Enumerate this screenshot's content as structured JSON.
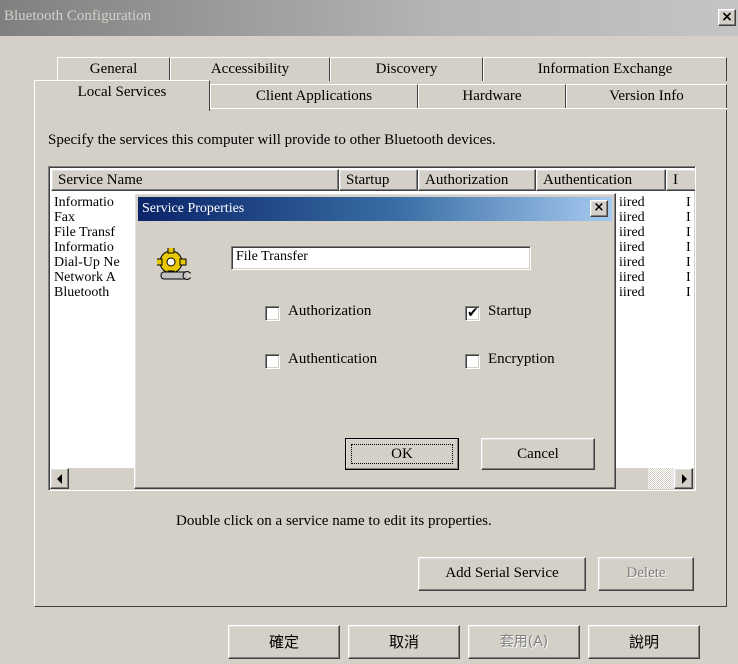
{
  "window": {
    "title": "Bluetooth Configuration",
    "close_glyph": "×"
  },
  "tabs": {
    "row1": [
      "General",
      "Accessibility",
      "Discovery",
      "Information Exchange"
    ],
    "row2": [
      "Local Services",
      "Client Applications",
      "Hardware",
      "Version Info"
    ],
    "selected": "Local Services"
  },
  "local_services": {
    "instruction": "Specify the services this computer will provide to other Bluetooth devices.",
    "columns": [
      "Service Name",
      "Startup",
      "Authorization",
      "Authentication",
      "I"
    ],
    "rows": [
      {
        "name": "Informatio",
        "auth_suffix": "iired",
        "last": "I"
      },
      {
        "name": "Fax",
        "auth_suffix": "iired",
        "last": "I"
      },
      {
        "name": "File Transf",
        "auth_suffix": "iired",
        "last": "I"
      },
      {
        "name": "Informatio",
        "auth_suffix": "iired",
        "last": "I"
      },
      {
        "name": "Dial-Up Ne",
        "auth_suffix": "iired",
        "last": "I"
      },
      {
        "name": "Network A",
        "auth_suffix": "iired",
        "last": "I"
      },
      {
        "name": "Bluetooth",
        "auth_suffix": "iired",
        "last": "I"
      }
    ],
    "help_text": "Double click on a service name to edit its properties.",
    "add_serial_label": "Add Serial Service",
    "delete_label": "Delete"
  },
  "service_properties": {
    "title": "Service Properties",
    "close_glyph": "×",
    "service_name": "File Transfer",
    "checkboxes": {
      "authorization": {
        "label": "Authorization",
        "checked": false
      },
      "startup": {
        "label": "Startup",
        "checked": true
      },
      "authentication": {
        "label": "Authentication",
        "checked": false
      },
      "encryption": {
        "label": "Encryption",
        "checked": false
      }
    },
    "ok_label": "OK",
    "cancel_label": "Cancel"
  },
  "footer": {
    "ok_label": "確定",
    "cancel_label": "取消",
    "apply_label": "套用(A)",
    "help_label": "說明"
  },
  "icons": {
    "service": "gear-wrench-icon",
    "scroll_left": "left-arrow-icon",
    "scroll_right": "right-arrow-icon",
    "check": "checkmark-icon"
  }
}
